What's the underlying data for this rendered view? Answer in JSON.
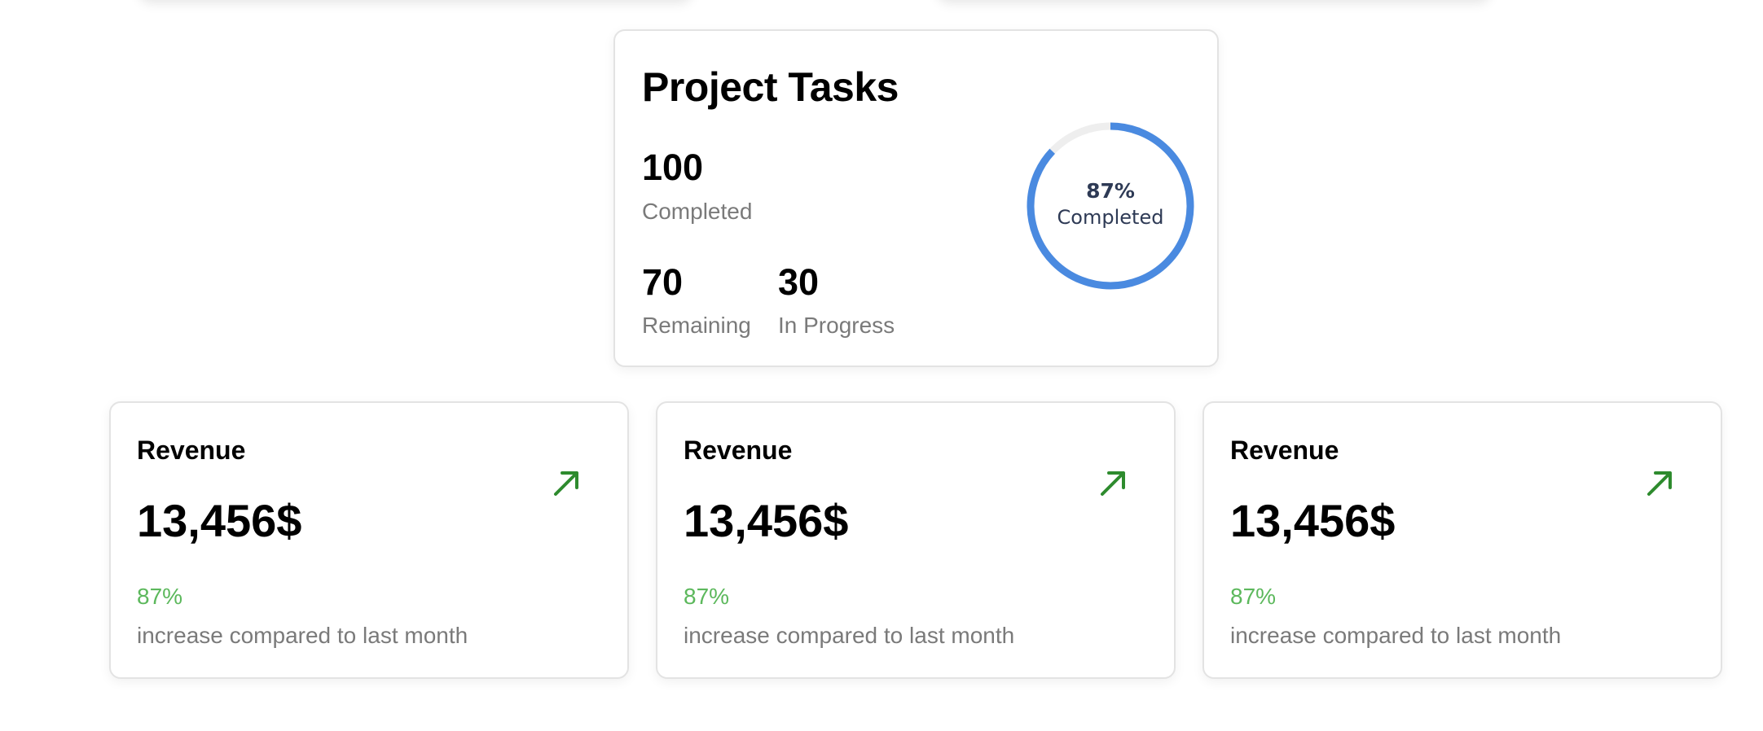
{
  "colors": {
    "ring_progress": "#4a8ae0",
    "ring_track": "#eeeeee",
    "positive": "#5cb85c",
    "trend_arrow": "#2e8b2e"
  },
  "tasks": {
    "title": "Project Tasks",
    "completed": {
      "value": "100",
      "label": "Completed"
    },
    "remaining": {
      "value": "70",
      "label": "Remaining"
    },
    "in_progress": {
      "value": "30",
      "label": "In Progress"
    },
    "ring": {
      "percent_text": "87%",
      "label": "Completed",
      "fraction": 0.87
    }
  },
  "revenue_cards": [
    {
      "title": "Revenue",
      "value": "13,456$",
      "change": "87%",
      "description": "increase compared to last month",
      "icon": "trend-up-icon"
    },
    {
      "title": "Revenue",
      "value": "13,456$",
      "change": "87%",
      "description": "increase compared to last month",
      "icon": "trend-up-icon"
    },
    {
      "title": "Revenue",
      "value": "13,456$",
      "change": "87%",
      "description": "increase compared to last month",
      "icon": "trend-up-icon"
    }
  ]
}
